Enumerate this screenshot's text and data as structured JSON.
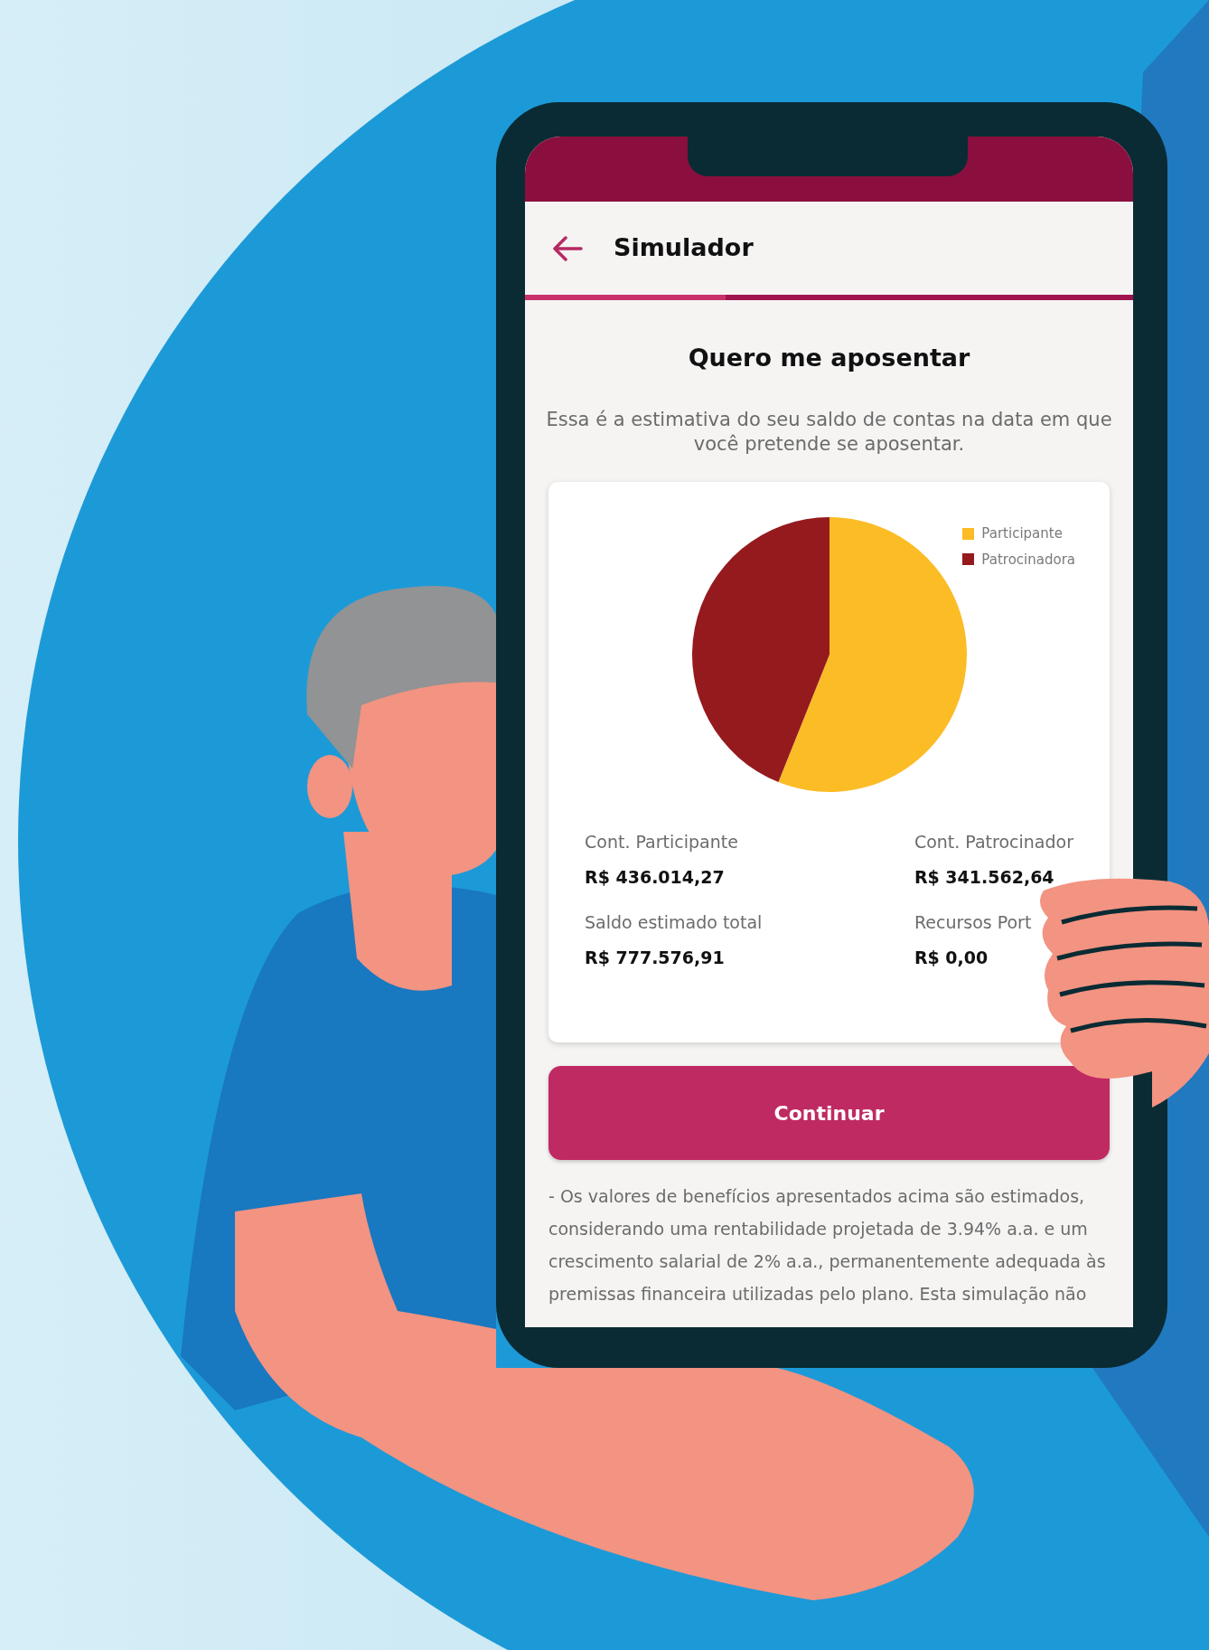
{
  "app_bar": {
    "title": "Simulador"
  },
  "progress": {
    "level": 0.33
  },
  "heading": "Quero me aposentar",
  "description": "Essa é a estimativa do seu saldo de contas na data em que você pretende se aposentar.",
  "card": {
    "chart_data": {
      "type": "pie",
      "categories": [
        "Participante",
        "Patrocinadora"
      ],
      "values": [
        56.07,
        43.93
      ],
      "colors": [
        "#fbbc26",
        "#951a1e"
      ]
    },
    "summary": [
      {
        "label": "Cont. Participante",
        "value": "R$ 436.014,27"
      },
      {
        "label": "Cont. Patrocinador",
        "value": "R$ 341.562,64"
      },
      {
        "label": "Saldo estimado total",
        "value": "R$ 777.576,91"
      },
      {
        "label": "Recursos Port",
        "value": "R$ 0,00"
      }
    ]
  },
  "button": {
    "label": "Continuar"
  },
  "disclaimer": "- Os valores de benefícios apresentados acima são estimados, considerando uma rentabilidade projetada de 3.94% a.a. e um crescimento salarial de 2% a.a., permanentemente adequada às premissas financeira utilizadas pelo plano. Esta simulação não"
}
